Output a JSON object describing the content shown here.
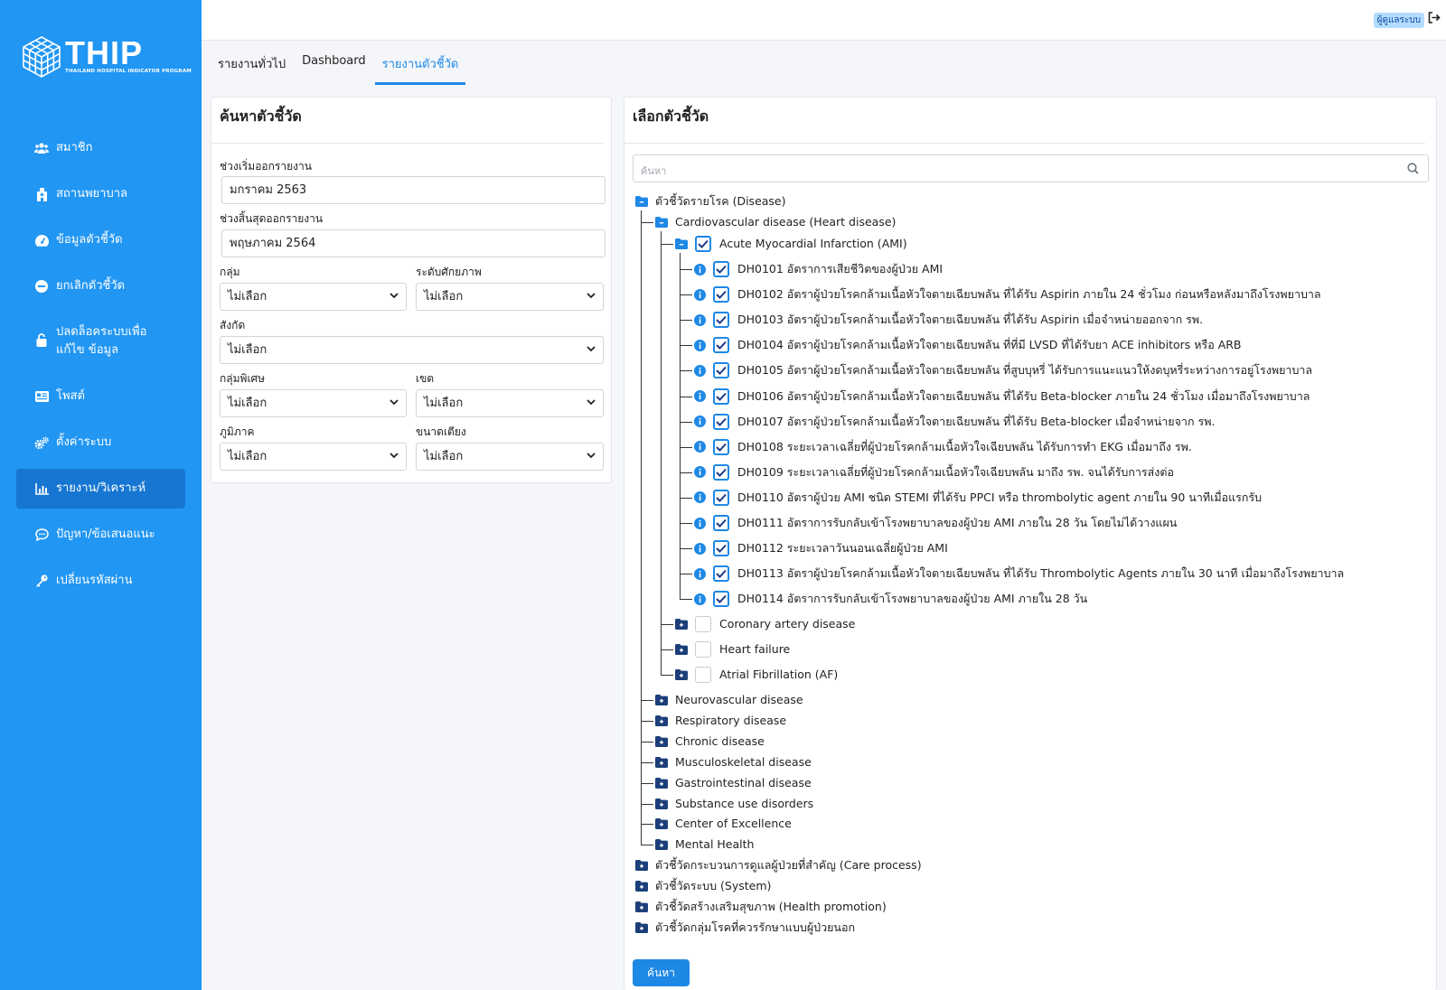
{
  "app": {
    "logo_text": "THIP",
    "logo_sub": "THAILAND HOSPITAL INDICATOR PROGRAM"
  },
  "sidebar": {
    "items": [
      {
        "label": "สมาชิก",
        "icon": "users-icon"
      },
      {
        "label": "สถานพยาบาล",
        "icon": "hospital-icon"
      },
      {
        "label": "ข้อมูลตัวชี้วัด",
        "icon": "gauge-icon"
      },
      {
        "label": "ยกเลิกตัวชี้วัด",
        "icon": "minus-circle-icon"
      },
      {
        "label": "ปลดล็อคระบบเพื่อแก้ไข ข้อมูล",
        "icon": "unlock-icon"
      },
      {
        "label": "โพสต์",
        "icon": "post-icon"
      },
      {
        "label": "ตั้งค่าระบบ",
        "icon": "cogs-icon"
      },
      {
        "label": "รายงาน/วิเคราะห์",
        "icon": "chart-icon",
        "active": true
      },
      {
        "label": "ปัญหา/ข้อเสนอแนะ",
        "icon": "comment-icon"
      },
      {
        "label": "เปลี่ยนรหัสผ่าน",
        "icon": "key-icon"
      }
    ]
  },
  "topbar": {
    "user_badge": "ผู้ดูแลระบบ"
  },
  "tabs": [
    {
      "label": "รายงานทั่วไป"
    },
    {
      "label": "Dashboard"
    },
    {
      "label": "รายงานตัวชี้วัด",
      "active": true
    }
  ],
  "search_panel": {
    "title": "ค้นหาตัวชี้วัด",
    "start_label": "ช่วงเริ่มออกรายงาน",
    "start_value": "มกราคม 2563",
    "end_label": "ช่วงสิ้นสุดออกรายงาน",
    "end_value": "พฤษภาคม 2564",
    "group_label": "กลุ่ม",
    "group_value": "ไม่เลือก",
    "level_label": "ระดับศักยภาพ",
    "level_value": "ไม่เลือก",
    "affiliation_label": "สังกัด",
    "affiliation_value": "ไม่เลือก",
    "special_label": "กลุ่มพิเศษ",
    "special_value": "ไม่เลือก",
    "zone_label": "เขต",
    "zone_value": "ไม่เลือก",
    "region_label": "ภูมิภาค",
    "region_value": "ไม่เลือก",
    "beds_label": "ขนาดเตียง",
    "beds_value": "ไม่เลือก"
  },
  "select_panel": {
    "title": "เลือกตัวชี้วัด",
    "search_placeholder": "ค้นหา",
    "search_button": "ค้นหา",
    "root": "ตัวชี้วัดรายโรค (Disease)",
    "cardio": "Cardiovascular disease (Heart disease)",
    "ami": "Acute Myocardial Infarction (AMI)",
    "ami_items": [
      "DH0101 อัตราการเสียชีวิตของผู้ป่วย AMI",
      "DH0102 อัตราผู้ป่วยโรคกล้ามเนื้อหัวใจตายเฉียบพลัน ที่ได้รับ Aspirin ภายใน 24 ชั่วโมง ก่อนหรือหลังมาถึงโรงพยาบาล",
      "DH0103 อัตราผู้ป่วยโรคกล้ามเนื้อหัวใจตายเฉียบพลัน ที่ได้รับ Aspirin เมื่อจำหน่ายออกจาก รพ.",
      "DH0104 อัตราผู้ป่วยโรคกล้ามเนื้อหัวใจตายเฉียบพลัน ที่ที่มี LVSD ที่ได้รับยา ACE inhibitors หรือ ARB",
      "DH0105 อัตราผู้ป่วยโรคกล้ามเนื้อหัวใจตายเฉียบพลัน ที่สูบบุหรี่ ได้รับการแนะแนวให้งดบุหรี่ระหว่างการอยู่โรงพยาบาล",
      "DH0106 อัตราผู้ป่วยโรคกล้ามเนื้อหัวใจตายเฉียบพลัน ที่ได้รับ Beta-blocker ภายใน 24 ชั่วโมง เมื่อมาถึงโรงพยาบาล",
      "DH0107 อัตราผู้ป่วยโรคกล้ามเนื้อหัวใจตายเฉียบพลัน ที่ได้รับ Beta-blocker เมื่อจำหน่ายจาก รพ.",
      "DH0108 ระยะเวลาเฉลี่ยที่ผู้ป่วยโรคกล้ามเนื้อหัวใจเฉียบพลัน ได้รับการทำ EKG เมื่อมาถึง รพ.",
      "DH0109 ระยะเวลาเฉลี่ยที่ผู้ป่วยโรคกล้ามเนื้อหัวใจเฉียบพลัน มาถึง รพ. จนได้รับการส่งต่อ",
      "DH0110 อัตราผู้ป่วย AMI ชนิด STEMI ที่ได้รับ PPCI หรือ thrombolytic agent ภายใน 90 นาทีเมื่อแรกรับ",
      "DH0111 อัตราการรับกลับเข้าโรงพยาบาลของผู้ป่วย AMI ภายใน 28 วัน โดยไม่ได้วางแผน",
      "DH0112 ระยะเวลาวันนอนเฉลี่ยผู้ป่วย AMI",
      "DH0113 อัตราผู้ป่วยโรคกล้ามเนื้อหัวใจตายเฉียบพลัน ที่ได้รับ Thrombolytic Agents ภายใน 30 นาที เมื่อมาถึงโรงพยาบาล",
      "DH0114 อัตราการรับกลับเข้าโรงพยาบาลของผู้ป่วย AMI ภายใน 28 วัน"
    ],
    "cardio_siblings": [
      "Coronary artery disease",
      "Heart failure",
      "Atrial Fibrillation (AF)"
    ],
    "disease_groups": [
      "Neurovascular disease",
      "Respiratory disease",
      "Chronic disease",
      "Musculoskeletal disease",
      "Gastrointestinal disease",
      "Substance use disorders",
      "Center of Excellence",
      "Mental Health"
    ],
    "root_groups": [
      "ตัวชี้วัดกระบวนการดูแลผู้ป่วยที่สำคัญ (Care process)",
      "ตัวชี้วัดระบบ (System)",
      "ตัวชี้วัดสร้างเสริมสุขภาพ (Health promotion)",
      "ตัวชี้วัดกลุ่มโรคที่ควรรักษาแบบผู้ป่วยนอก"
    ]
  },
  "colors": {
    "sidebar": "#2196f3",
    "sidebar_active": "#1676d2",
    "accent": "#1e88e5"
  }
}
